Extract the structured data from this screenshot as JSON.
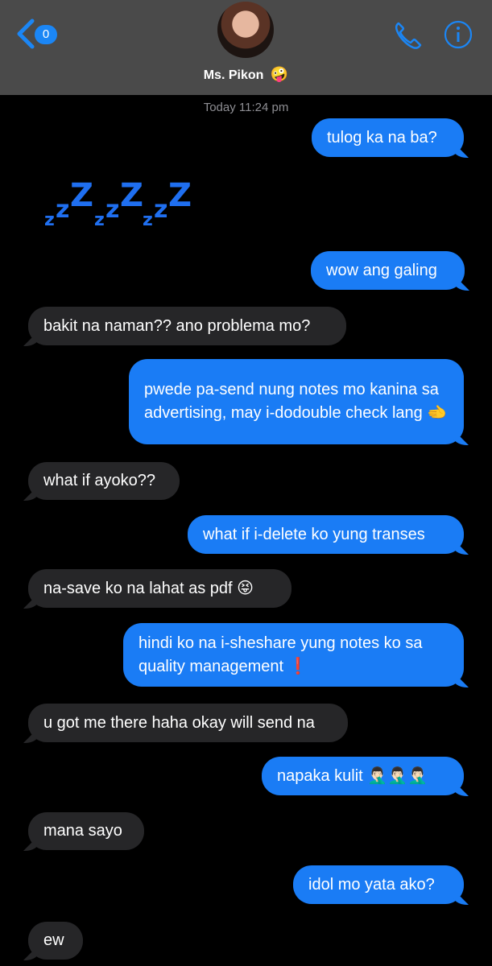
{
  "header": {
    "back_badge": "0",
    "contact_name": "Ms. Pikon",
    "contact_emoji": "🤪"
  },
  "timestamp": "Today 11:24 pm",
  "sticker_text": "zzzzzz",
  "messages": [
    {
      "dir": "out",
      "text": "tulog ka na ba?"
    },
    {
      "dir": "out",
      "text": "wow ang galing"
    },
    {
      "dir": "in",
      "text": "bakit na naman?? ano problema mo?"
    },
    {
      "dir": "out",
      "text": "pwede pa-send nung notes mo kanina sa advertising, may i-dodouble check lang 🫲"
    },
    {
      "dir": "in",
      "text": "what if ayoko??"
    },
    {
      "dir": "out",
      "text": "what if i-delete ko yung transes"
    },
    {
      "dir": "in",
      "text": "na-save ko na lahat as pdf 😝"
    },
    {
      "dir": "out",
      "text": "hindi ko na i-sheshare yung notes ko sa quality management ❗"
    },
    {
      "dir": "in",
      "text": "u got me there haha okay will send na"
    },
    {
      "dir": "out",
      "text": "napaka kulit 🤦🏻‍♂️🤦🏻‍♂️🤦🏻‍♂️"
    },
    {
      "dir": "in",
      "text": "mana sayo"
    },
    {
      "dir": "out",
      "text": "idol mo yata ako?"
    },
    {
      "dir": "in",
      "text": "ew"
    }
  ],
  "colors": {
    "header_bg": "#4a4a4a",
    "accent": "#1b86f5",
    "outgoing_bubble": "#1a7cf5",
    "incoming_bubble": "#262628"
  }
}
